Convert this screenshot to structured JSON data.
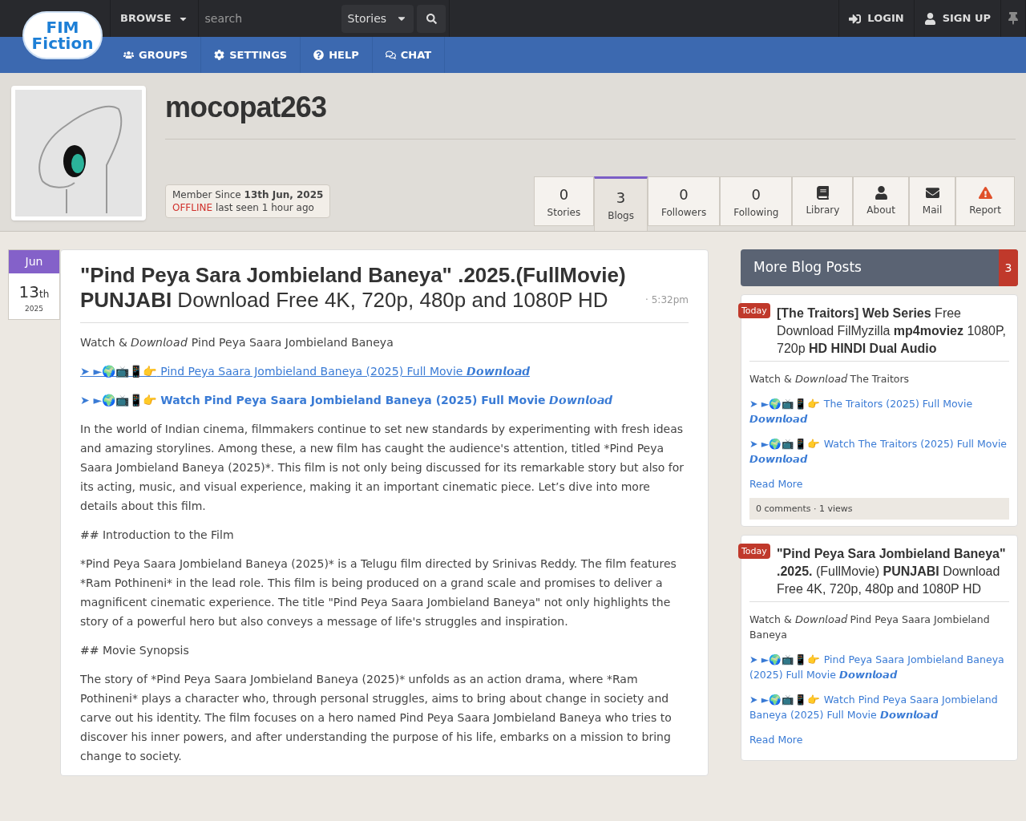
{
  "topbar": {
    "logo": {
      "line1": "FIM",
      "line2": "Fiction"
    },
    "browse": "BROWSE",
    "search": {
      "placeholder": "search"
    },
    "scope": "Stories",
    "right": [
      {
        "kind": "login",
        "label": "LOGIN"
      },
      {
        "kind": "signup",
        "label": "SIGN UP"
      }
    ]
  },
  "nav": [
    {
      "kind": "groups",
      "label": "GROUPS"
    },
    {
      "kind": "settings",
      "label": "SETTINGS"
    },
    {
      "kind": "help",
      "label": "HELP"
    },
    {
      "kind": "chat",
      "label": "CHAT"
    }
  ],
  "profile": {
    "username": "mocopat263",
    "member_since_label": "Member Since",
    "member_since": "13th Jun, 2025",
    "status": "OFFLINE",
    "last_seen": "last seen 1 hour ago",
    "tabs": [
      {
        "kind": "count",
        "value": "0",
        "label": "Stories",
        "selected": false
      },
      {
        "kind": "count",
        "value": "3",
        "label": "Blogs",
        "selected": true
      },
      {
        "kind": "count",
        "value": "0",
        "label": "Followers",
        "selected": false
      },
      {
        "kind": "count",
        "value": "0",
        "label": "Following",
        "selected": false
      },
      {
        "kind": "library",
        "label": "Library",
        "selected": false
      },
      {
        "kind": "about",
        "label": "About",
        "selected": false
      },
      {
        "kind": "mail",
        "label": "Mail",
        "selected": false
      },
      {
        "kind": "report",
        "label": "Report",
        "selected": false
      }
    ]
  },
  "post": {
    "date": {
      "month": "Jun",
      "day": "13",
      "suffix": "th",
      "year": "2025"
    },
    "title": "**\"Pind Peya Sara Jombieland Baneya\" .2025.(FullMovie) PUNJABI** Download Free 4K, 720p, 480p and 1080P HD",
    "time": "· 5:32pm",
    "body": [
      {
        "kind": "text",
        "text": "Watch & 𝘋𝘰𝘸𝘯𝘭𝘰𝘢𝘥 Pind Peya Saara Jombieland Baneya"
      },
      {
        "kind": "link",
        "prefix": "➤ ►🌍📺📱👉",
        "text": "Pind Peya Saara Jombieland Baneya (2025) Full Movie 𝘿𝙤𝙬𝙣𝙡𝙤𝙖𝙙",
        "underline": true
      },
      {
        "kind": "link",
        "prefix": "➤ ►🌍📺📱👉",
        "text": "Watch Pind Peya Saara Jombieland Baneya (2025) Full Movie 𝘿𝙤𝙬𝙣𝙡𝙤𝙖𝙙",
        "underline": false
      },
      {
        "kind": "text",
        "text": "In the world of Indian cinema, filmmakers continue to set new standards by experimenting with fresh ideas and amazing storylines. Among these, a new film has caught the audience's attention, titled *Pind Peya Saara Jombieland Baneya (2025)*. This film is not only being discussed for its remarkable story but also for its acting, music, and visual experience, making it an important cinematic piece. Let’s dive into more details about this film."
      },
      {
        "kind": "text",
        "text": "## Introduction to the Film"
      },
      {
        "kind": "text",
        "text": "*Pind Peya Saara Jombieland Baneya (2025)* is a Telugu film directed by Srinivas Reddy. The film features *Ram Pothineni* in the lead role. This film is being produced on a grand scale and promises to deliver a magnificent cinematic experience. The title \"Pind Peya Saara Jombieland Baneya\" not only highlights the story of a powerful hero but also conveys a message of life's struggles and inspiration."
      },
      {
        "kind": "text",
        "text": "## Movie Synopsis"
      },
      {
        "kind": "text",
        "text": "The story of *Pind Peya Saara Jombieland Baneya (2025)* unfolds as an action drama, where *Ram Pothineni* plays a character who, through personal struggles, aims to bring about change in society and carve out his identity. The film focuses on a hero named Pind Peya Saara Jombieland Baneya who tries to discover his inner powers, and after understanding the purpose of his life, embarks on a mission to bring change to society."
      }
    ]
  },
  "sidebar": {
    "title": "More Blog Posts",
    "count": "3",
    "posts": [
      {
        "badge": "Today",
        "title": "**[The Traitors] Web Series** Free Download FilMyzilla **mp4moviez** 1080P, 720p **HD HINDI Dual Audio**",
        "body": [
          {
            "kind": "text",
            "text": "Watch & 𝘋𝘰𝘸𝘯𝘭𝘰𝘢𝘥 The Traitors"
          },
          {
            "kind": "link",
            "prefix": "➤ ►🌍📺📱👉",
            "text": "The Traitors (2025) Full Movie 𝘿𝙤𝙬𝙣𝙡𝙤𝙖𝙙"
          },
          {
            "kind": "link",
            "prefix": "➤ ►🌍📺📱👉",
            "text": "Watch The Traitors (2025) Full Movie 𝘿𝙤𝙬𝙣𝙡𝙤𝙖𝙙"
          }
        ],
        "read_more": "Read More",
        "footer": "0 comments · 1 views"
      },
      {
        "badge": "Today",
        "title": "**\"Pind Peya Sara Jombieland Baneya\" .2025.** (FullMovie) **PUNJABI** Download Free 4K, 720p, 480p and 1080P HD",
        "body": [
          {
            "kind": "text",
            "text": "Watch & 𝘋𝘰𝘸𝘯𝘭𝘰𝘢𝘥 Pind Peya Saara Jombieland Baneya"
          },
          {
            "kind": "link",
            "prefix": "➤ ►🌍📺📱👉",
            "text": "Pind Peya Saara Jombieland Baneya (2025) Full Movie 𝘿𝙤𝙬𝙣𝙡𝙤𝙖𝙙"
          },
          {
            "kind": "link",
            "prefix": "➤ ►🌍📺📱👉",
            "text": "Watch Pind Peya Saara Jombieland Baneya (2025) Full Movie 𝘿𝙤𝙬𝙣𝙡𝙤𝙖𝙙"
          }
        ],
        "read_more": "Read More"
      }
    ]
  }
}
